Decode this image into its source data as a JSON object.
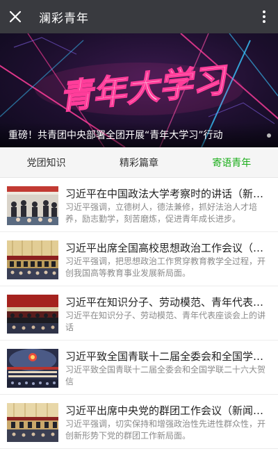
{
  "header": {
    "title": "澜彩青年",
    "close_icon": "close-icon",
    "more_icon": "more-vertical-icon"
  },
  "banner": {
    "art_text": "青年大学习",
    "headline": "重磅！共青团中央部署全团开展“青年大学习”行动"
  },
  "tabs": [
    {
      "label": "党团知识",
      "active": false
    },
    {
      "label": "精彩篇章",
      "active": false
    },
    {
      "label": "寄语青年",
      "active": true
    }
  ],
  "colors": {
    "topbar": "#393a3f",
    "active_tab": "#1aad19",
    "banner_pink": "#ff3d9a"
  },
  "articles": [
    {
      "title": "习近平在中国政法大学考察时的讲话（新闻...",
      "desc": "习近平强调，立德树人，德法兼修，抓好法治人才培养，励志勤学，刻苦磨炼，促进青年成长进步。"
    },
    {
      "title": "习近平出席全国高校思想政治工作会议（新...",
      "desc": "习近平强调，把思想政治工作贯穿教育教学全过程，开创我国高等教育事业发展新局面。"
    },
    {
      "title": "习近平在知识分子、劳动模范、青年代表座...",
      "desc": "习近平在知识分子、劳动模范、青年代表座谈会上的讲话"
    },
    {
      "title": "习近平致全国青联十二届全委会和全国学联...",
      "desc": "习近平致全国青联十二届全委会和全国学联二十六大贺信"
    },
    {
      "title": "习近平出席中央党的群团工作会议（新闻稿...",
      "desc": "习近平强调，切实保持和增强政治性先进性群众性，开创新形势下党的群团工作新局面。"
    }
  ]
}
